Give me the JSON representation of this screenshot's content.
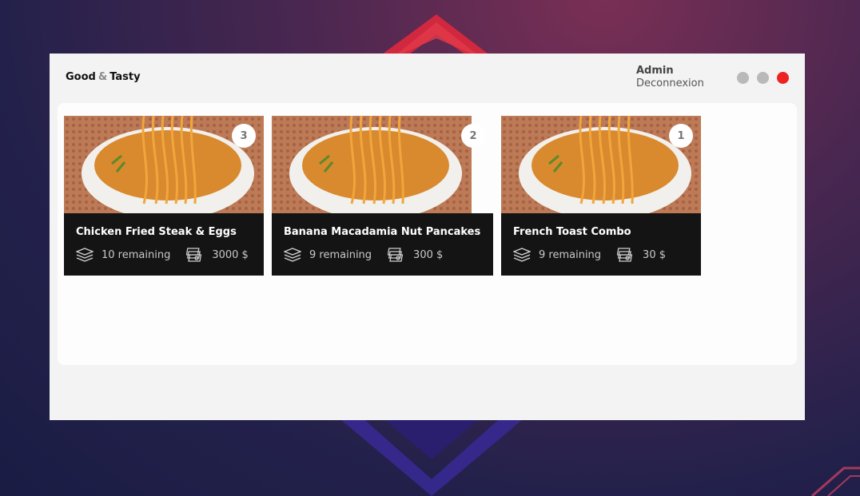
{
  "brand": {
    "first": "Good",
    "amp": "&",
    "second": "Tasty"
  },
  "user": {
    "name": "Admin",
    "logout_label": "Deconnexion"
  },
  "window_controls": [
    {
      "name": "minimize",
      "color": "#b9b9b9"
    },
    {
      "name": "maximize",
      "color": "#b9b9b9"
    },
    {
      "name": "close",
      "color": "#ee2222"
    }
  ],
  "products": [
    {
      "badge": "3",
      "title": "Chicken Fried Steak & Eggs",
      "remaining": "10 remaining",
      "price": "3000 $",
      "image_icon": "noodle-bowl-photo"
    },
    {
      "badge": "2",
      "title": "Banana Macadamia Nut Pancakes",
      "remaining": "9 remaining",
      "price": "300 $",
      "image_icon": "noodle-bowl-photo"
    },
    {
      "badge": "1",
      "title": "French Toast Combo",
      "remaining": "9 remaining",
      "price": "30 $",
      "image_icon": "noodle-bowl-photo"
    }
  ],
  "icons": {
    "stock": "layers-icon",
    "price": "money-stack-icon"
  }
}
